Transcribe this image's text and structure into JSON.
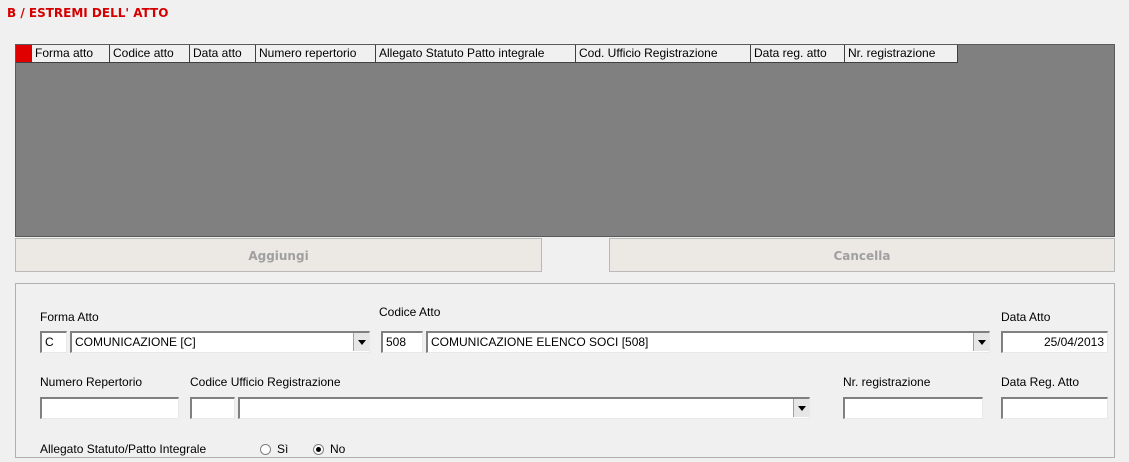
{
  "section": {
    "title": "B / ESTREMI DELL' ATTO"
  },
  "grid": {
    "columns": [
      "Forma atto",
      "Codice atto",
      "Data atto",
      "Numero repertorio",
      "Allegato Statuto Patto integrale",
      "Cod. Ufficio Registrazione",
      "Data reg. atto",
      "Nr. registrazione"
    ]
  },
  "buttons": {
    "add": "Aggiungi",
    "delete": "Cancella"
  },
  "form": {
    "forma_atto": {
      "label": "Forma Atto",
      "code": "C",
      "value": "COMUNICAZIONE [C]"
    },
    "codice_atto": {
      "label": "Codice Atto",
      "code": "508",
      "value": "COMUNICAZIONE ELENCO SOCI [508]"
    },
    "data_atto": {
      "label": "Data Atto",
      "value": "25/04/2013"
    },
    "numero_repertorio": {
      "label": "Numero Repertorio",
      "value": ""
    },
    "codice_ufficio": {
      "label": "Codice Ufficio Registrazione",
      "code": "",
      "value": ""
    },
    "nr_registrazione": {
      "label": "Nr. registrazione",
      "value": ""
    },
    "data_reg_atto": {
      "label": "Data Reg. Atto",
      "value": ""
    },
    "allegato": {
      "label": "Allegato Statuto/Patto Integrale",
      "options": [
        "Sì",
        "No"
      ],
      "selected": "No"
    }
  }
}
